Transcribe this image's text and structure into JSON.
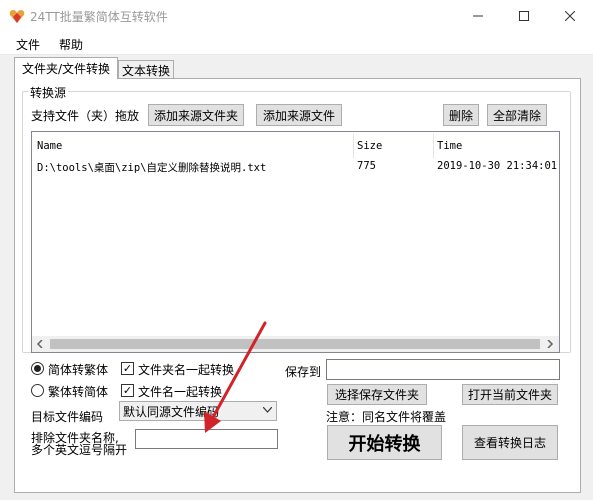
{
  "window": {
    "title": "24TT批量繁简体互转软件"
  },
  "menu": {
    "file": "文件",
    "help": "帮助"
  },
  "tabs": [
    "文件夹/文件转换",
    "文本转换"
  ],
  "source_group": {
    "title": "转换源",
    "drag_hint": "支持文件（夹）拖放",
    "add_folder": "添加来源文件夹",
    "add_file": "添加来源文件",
    "delete": "删除",
    "clear_all": "全部清除"
  },
  "file_list": {
    "columns": [
      "Name",
      "Size",
      "Time"
    ],
    "rows": [
      {
        "name": "D:\\tools\\桌面\\zip\\自定义删除替换说明.txt",
        "size": "775",
        "time": "2019-10-30 21:34:01"
      }
    ]
  },
  "options": {
    "s2t": "简体转繁体",
    "t2s": "繁体转简体",
    "selected": "s2t",
    "folder_name_too": "文件夹名一起转换",
    "file_name_too": "文件名一起转换",
    "target_encoding_label": "目标文件编码",
    "target_encoding_value": "默认同源文件编码",
    "exclude_label_1": "排除文件夹名称,",
    "exclude_label_2": "多个英文逗号隔开"
  },
  "output": {
    "save_to_label": "保存到",
    "choose_folder": "选择保存文件夹",
    "open_folder": "打开当前文件夹",
    "notice": "注意：同名文件将覆盖",
    "start": "开始转换",
    "view_log": "查看转换日志"
  }
}
